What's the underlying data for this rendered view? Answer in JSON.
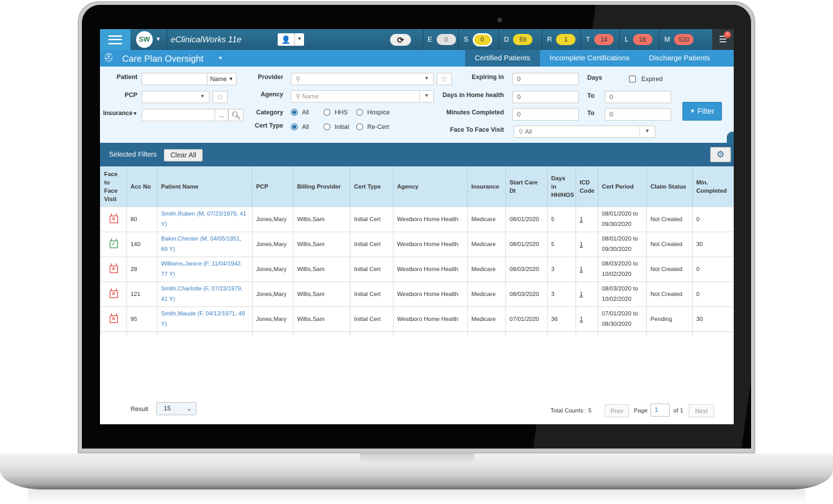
{
  "topbar": {
    "user_initials": "SW",
    "app_title": "eClinicalWorks 11e",
    "menu_icon": "hamburger-icon",
    "patient_lookup_icon": "patient-search-icon",
    "refresh_icon": "refresh-icon",
    "jellybeans": [
      {
        "label": "E",
        "count": "0",
        "color": "grey",
        "selected": false
      },
      {
        "label": "S",
        "count": "0",
        "color": "yellow",
        "selected": true
      },
      {
        "label": "D",
        "count": "59",
        "color": "yellow",
        "selected": false
      },
      {
        "label": "R",
        "count": "1",
        "color": "yellow",
        "selected": false
      },
      {
        "label": "T",
        "count": "14",
        "color": "red",
        "selected": false
      },
      {
        "label": "L",
        "count": "18",
        "color": "red",
        "selected": false
      },
      {
        "label": "M",
        "count": "520",
        "color": "red",
        "selected": false
      }
    ],
    "notification_count": "0"
  },
  "subbar": {
    "title": "Care Plan Oversight",
    "tabs": [
      {
        "label": "Certified Patients",
        "active": true
      },
      {
        "label": "Incomplete Certifications",
        "active": false
      },
      {
        "label": "Discharge Patients",
        "active": false
      }
    ]
  },
  "filters": {
    "patient_label": "Patient",
    "patient_value": "",
    "patient_mode": "Name",
    "pcp_label": "PCP",
    "pcp_value": "",
    "insurance_label": "Insurance",
    "insurance_value": "",
    "insurance_more": "...",
    "provider_label": "Provider",
    "provider_value": "",
    "agency_label": "Agency",
    "agency_placeholder": "Name",
    "category_label": "Category",
    "category_options": [
      "All",
      "HHS",
      "Hospice"
    ],
    "category_selected": "All",
    "cert_type_label": "Cert Type",
    "cert_type_options": [
      "All",
      "Initial",
      "Re-Cert"
    ],
    "cert_type_selected": "All",
    "expiring_label": "Expiring in",
    "expiring_value": "0",
    "days_label": "Days",
    "expired_label": "Expired",
    "expired_checked": false,
    "days_hh_label": "Days in Home health",
    "days_hh_from": "0",
    "days_hh_to": "0",
    "minutes_label": "Minutes Completed",
    "minutes_from": "0",
    "minutes_to": "0",
    "to_label": "To",
    "f2f_label": "Face To Face Visit",
    "f2f_value": "All",
    "filter_button": "Filter"
  },
  "selected_filters": {
    "label": "Selected Filters",
    "clear_all": "Clear All"
  },
  "table": {
    "columns": [
      "Face to Face Visit",
      "Acc No",
      "Patient Name",
      "PCP",
      "Billing Provider",
      "Cert Type",
      "Agency",
      "Insurance",
      "Start Care Dt",
      "Days in HH/HOS",
      "ICD Code",
      "Cert Period",
      "Claim Status",
      "Min. Completed"
    ],
    "rows": [
      {
        "f2f": "missing",
        "acc": "80",
        "patient": "Smith,Ruben (M, 07/23/1979, 41 Y)",
        "pcp": "Jones,Mary",
        "billing": "Willis,Sam",
        "cert": "Initial Cert",
        "agency": "Westboro Home Health",
        "ins": "Medicare",
        "start": "08/01/2020",
        "days": "5",
        "icd": "1",
        "period": "08/01/2020 to 09/30/2020",
        "claim": "Not Created",
        "min": "0"
      },
      {
        "f2f": "done",
        "acc": "140",
        "patient": "Baker,Chester (M, 04/05/1951, 69 Y)",
        "pcp": "Jones,Mary",
        "billing": "Willis,Sam",
        "cert": "Initial Cert",
        "agency": "Westboro Home Health",
        "ins": "Medicare",
        "start": "08/01/2020",
        "days": "5",
        "icd": "1",
        "period": "08/01/2020 to 09/30/2020",
        "claim": "Not Created",
        "min": "30"
      },
      {
        "f2f": "missing",
        "acc": "28",
        "patient": "Williams,Janice (F, 11/04/1942, 77 Y)",
        "pcp": "Jones,Mary",
        "billing": "Willis,Sam",
        "cert": "Initial Cert",
        "agency": "Westboro Home Health",
        "ins": "Medicare",
        "start": "08/03/2020",
        "days": "3",
        "icd": "1",
        "period": "08/03/2020 to 10/02/2020",
        "claim": "Not Created",
        "min": "0"
      },
      {
        "f2f": "missing",
        "acc": "121",
        "patient": "Smith,Charlotte (F, 07/23/1979, 41 Y)",
        "pcp": "Jones,Mary",
        "billing": "Willis,Sam",
        "cert": "Initial Cert",
        "agency": "Westboro Home Health",
        "ins": "Medicare",
        "start": "08/03/2020",
        "days": "3",
        "icd": "1",
        "period": "08/03/2020 to 10/02/2020",
        "claim": "Not Created",
        "min": "0"
      },
      {
        "f2f": "missing",
        "acc": "95",
        "patient": "Smith,Maude (F, 04/12/1971, 49 Y)",
        "pcp": "Jones,Mary",
        "billing": "Willis,Sam",
        "cert": "Initial Cert",
        "agency": "Westboro Home Health",
        "ins": "Medicare",
        "start": "07/01/2020",
        "days": "36",
        "icd": "1",
        "period": "07/01/2020 to 08/30/2020",
        "claim": "Pending",
        "min": "30"
      }
    ]
  },
  "footer": {
    "result_label": "Result",
    "result_value": "15",
    "total_counts": "Total Counts : 5",
    "prev": "Prev",
    "page_label": "Page",
    "page_value": "1",
    "of_label": "of 1",
    "next": "Next"
  },
  "colors": {
    "topbar": "#2c7397",
    "subbar": "#3597d3",
    "selected_bar": "#2b6892",
    "header_bg": "#cde6f3",
    "filter_bg": "#eaf5fd",
    "link": "#3a7fc1",
    "missing_icon": "#e2453a",
    "done_icon": "#3d9a4c"
  }
}
